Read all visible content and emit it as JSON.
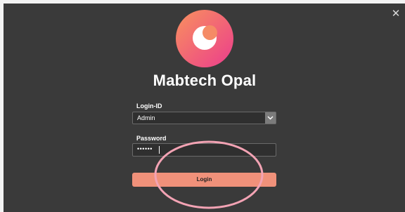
{
  "window": {
    "close_symbol": "✕"
  },
  "app": {
    "title": "Mabtech Opal",
    "logo_icon": "crescent-moon-logo",
    "brand_colors": {
      "logo_gradient_start": "#f8915e",
      "logo_gradient_end": "#ec3d8c",
      "accent": "#f0917a",
      "annotation": "#f3a3b4"
    }
  },
  "form": {
    "login_id_label": "Login-ID",
    "login_id_value": "Admin",
    "password_label": "Password",
    "password_value": "••••••",
    "login_button_label": "Login"
  }
}
